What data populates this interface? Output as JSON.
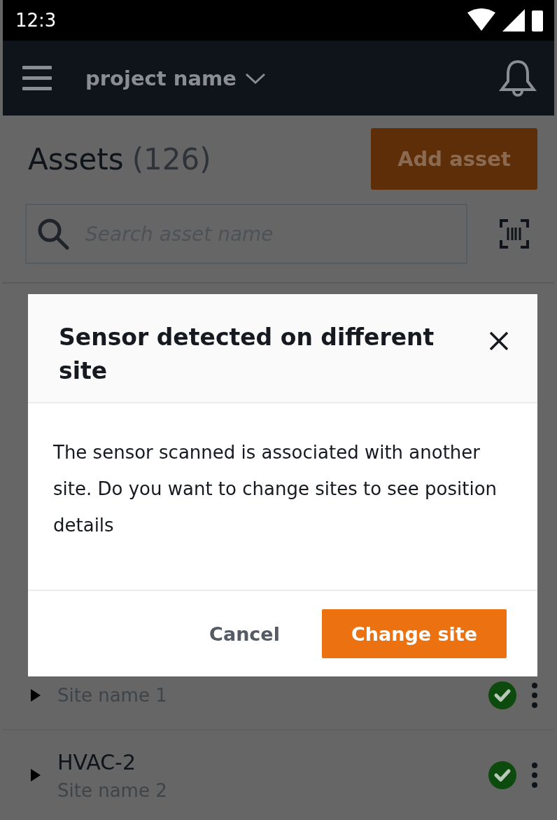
{
  "status_bar": {
    "time": "12:3"
  },
  "app_bar": {
    "project": "project name"
  },
  "header": {
    "title": "Assets",
    "count": "(126)",
    "add_button": "Add asset"
  },
  "search": {
    "placeholder": "Search asset name"
  },
  "assets": [
    {
      "site": "Site name 1",
      "healthy": true
    },
    {
      "name": "HVAC-2",
      "site": "Site name 2",
      "healthy": true
    }
  ],
  "dialog": {
    "title": "Sensor detected on different site",
    "body": "The sensor scanned is associated with another site. Do you want to change sites to see position details",
    "buttons": [
      {
        "label": "Cancel",
        "kind": "secondary"
      },
      {
        "label": "Change site",
        "kind": "primary"
      }
    ]
  }
}
